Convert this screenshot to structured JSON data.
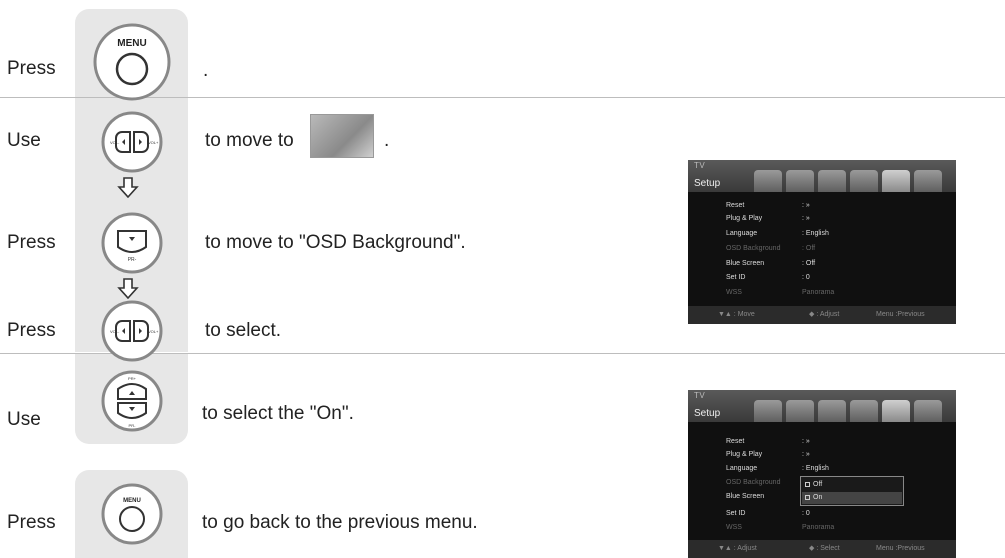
{
  "steps": {
    "s1": {
      "label": "Press",
      "text": "."
    },
    "s2": {
      "label": "Use",
      "text": "to move to",
      "tail": "."
    },
    "s3": {
      "label": "Press",
      "text": "to move to \"OSD Background\"."
    },
    "s4": {
      "label": "Press",
      "text": "to select."
    },
    "s5": {
      "label": "Use",
      "text": "to select the \"On\"."
    },
    "s6": {
      "label": "Press",
      "text": "to go back to the previous menu."
    }
  },
  "buttons": {
    "menu_label": "MENU",
    "vol_minus": "VOL-",
    "vol_plus": "VOL+",
    "pr_minus": "PR-",
    "pr_plus": "PR+"
  },
  "screen1": {
    "title": "TV",
    "section": "Setup",
    "rows": [
      {
        "key": "Reset",
        "val": ": »"
      },
      {
        "key": "Plug & Play",
        "val": ": »"
      },
      {
        "key": "Language",
        "val": ": English"
      },
      {
        "key": "OSD Background",
        "val": ": Off"
      },
      {
        "key": "Blue Screen",
        "val": ": Off"
      },
      {
        "key": "Set ID",
        "val": ": 0"
      },
      {
        "key": "WSS",
        "val": "Panorama"
      }
    ],
    "footer": {
      "move": "▼▲ : Move",
      "adjust": "◆ : Adjust",
      "menu": "Menu :Previous"
    }
  },
  "screen2": {
    "title": "TV",
    "section": "Setup",
    "rows": [
      {
        "key": "Reset",
        "val": ": »"
      },
      {
        "key": "Plug & Play",
        "val": ": »"
      },
      {
        "key": "Language",
        "val": ": English"
      },
      {
        "key": "OSD Background",
        "val": ":"
      },
      {
        "key": "Blue Screen",
        "val": ""
      },
      {
        "key": "Set ID",
        "val": ": 0"
      },
      {
        "key": "WSS",
        "val": "Panorama"
      }
    ],
    "popup": {
      "opt1": "Off",
      "opt2": "On"
    },
    "footer": {
      "move": "▼▲ : Adjust",
      "adjust": "◆ : Select",
      "menu": "Menu :Previous"
    }
  }
}
